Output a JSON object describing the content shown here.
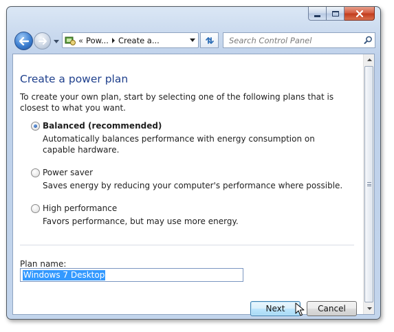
{
  "toolbar": {
    "breadcrumbs": [
      "Pow...",
      "Create a..."
    ],
    "search_placeholder": "Search Control Panel"
  },
  "page": {
    "title": "Create a power plan",
    "intro": "To create your own plan, start by selecting one of the following plans that is closest to what you want."
  },
  "plans": [
    {
      "label": "Balanced (recommended)",
      "description": "Automatically balances performance with energy consumption on capable hardware.",
      "selected": true
    },
    {
      "label": "Power saver",
      "description": "Saves energy by reducing your computer's performance where possible.",
      "selected": false
    },
    {
      "label": "High performance",
      "description": "Favors performance, but may use more energy.",
      "selected": false
    }
  ],
  "plan_name": {
    "label": "Plan name:",
    "value": "Windows 7 Desktop"
  },
  "buttons": {
    "next": "Next",
    "cancel": "Cancel"
  }
}
